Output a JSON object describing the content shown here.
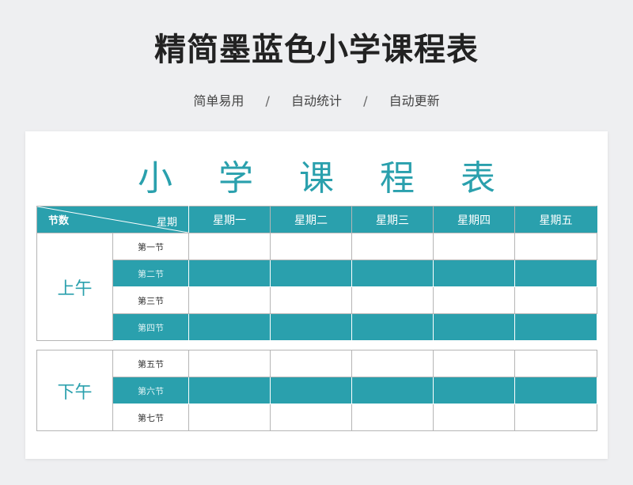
{
  "page": {
    "title": "精简墨蓝色小学课程表",
    "subtitle_items": [
      "简单易用",
      "自动统计",
      "自动更新"
    ],
    "separator": "/"
  },
  "sheet": {
    "title": "小学课程表",
    "header": {
      "corner_left": "节数",
      "corner_right": "星期",
      "days": [
        "星期一",
        "星期二",
        "星期三",
        "星期四",
        "星期五"
      ]
    },
    "morning": {
      "label": "上午",
      "slots": [
        "第一节",
        "第二节",
        "第三节",
        "第四节"
      ]
    },
    "afternoon": {
      "label": "下午",
      "slots": [
        "第五节",
        "第六节",
        "第七节"
      ]
    }
  },
  "colors": {
    "accent": "#2aa0ad",
    "background": "#eeeff1",
    "card": "#ffffff"
  }
}
